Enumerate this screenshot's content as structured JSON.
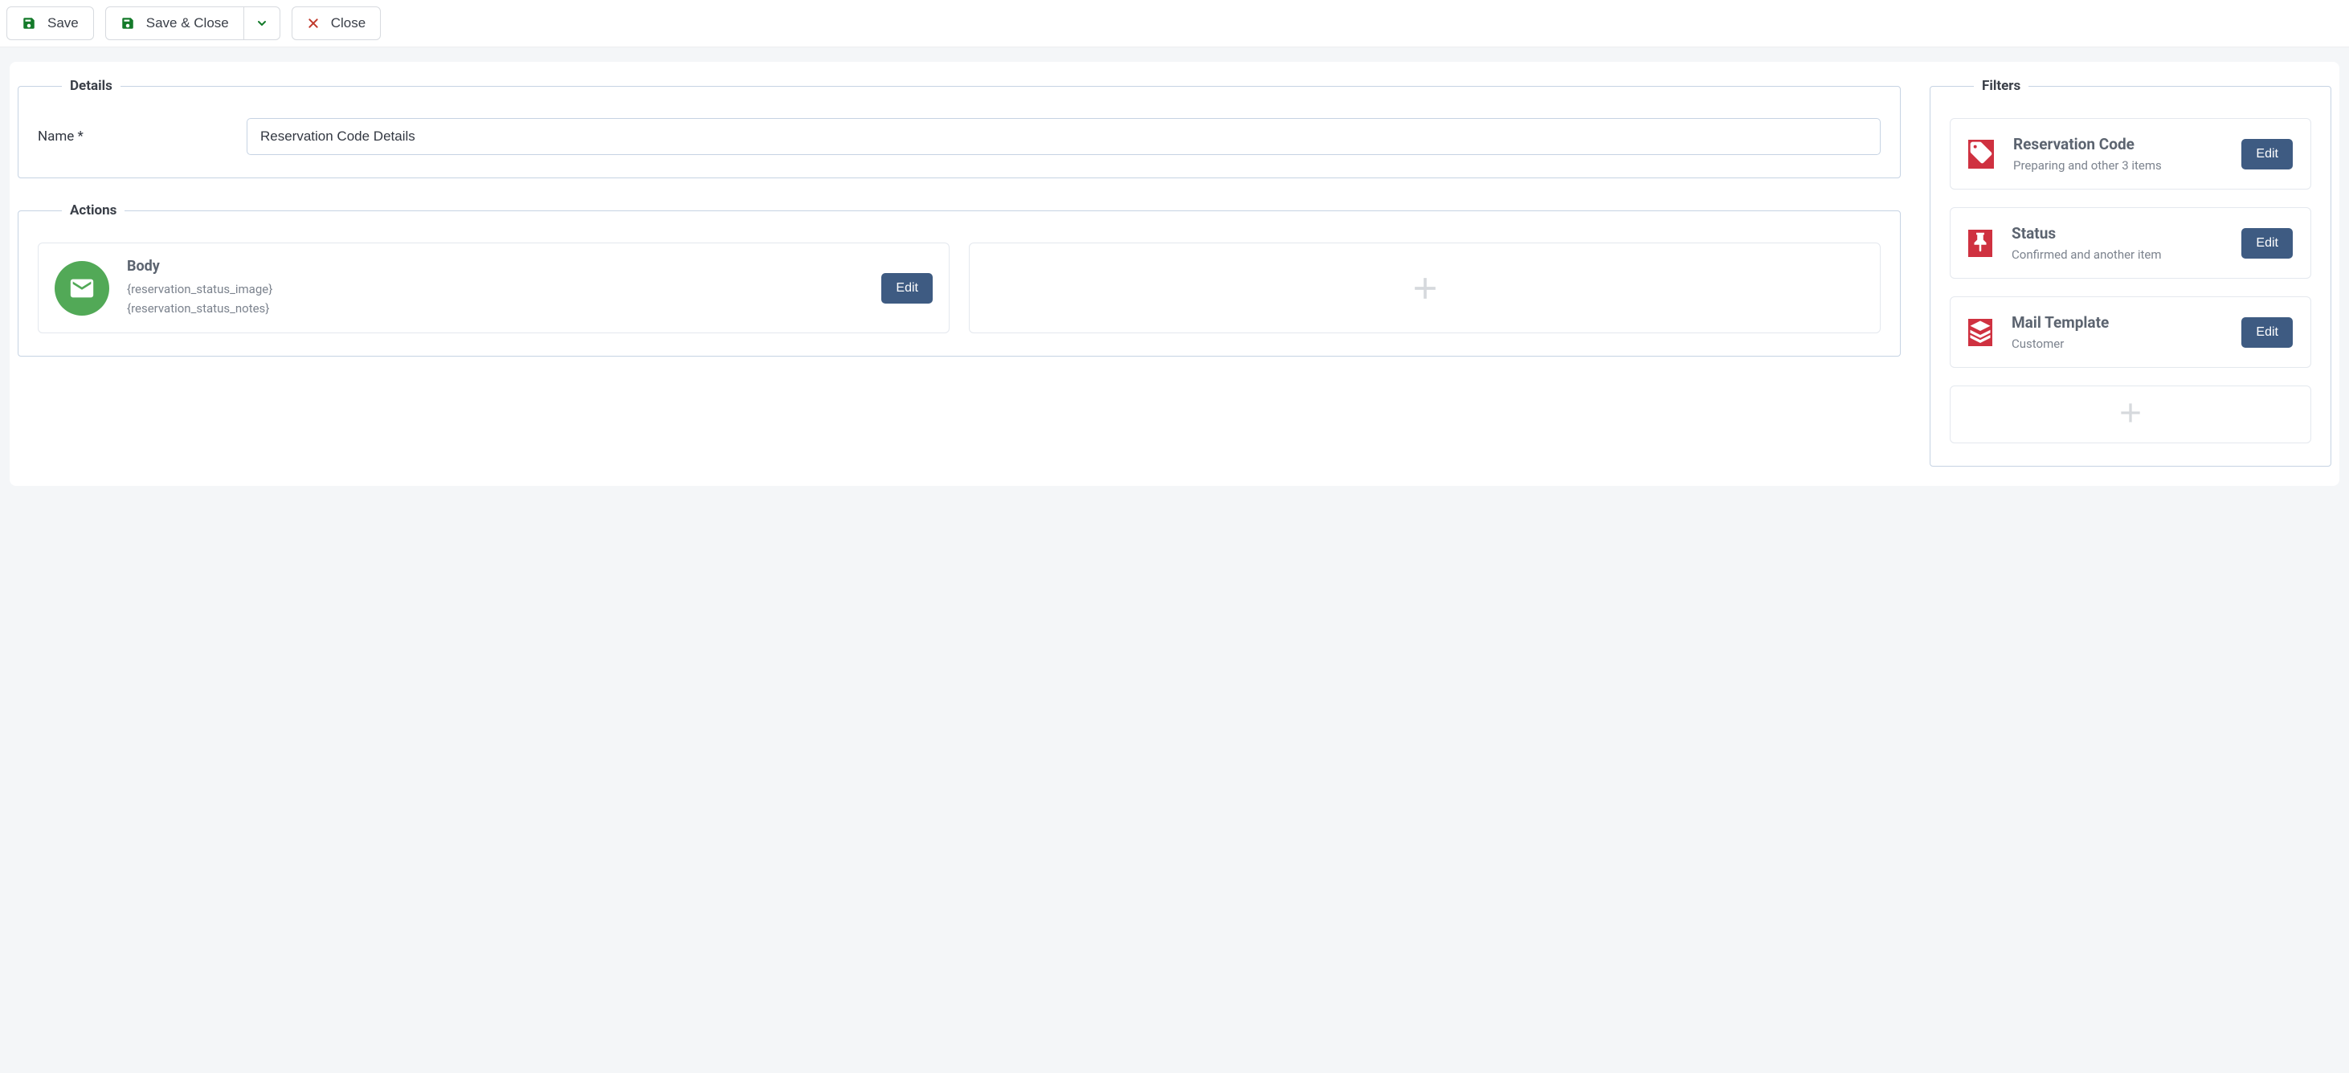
{
  "toolbar": {
    "save_label": "Save",
    "save_close_label": "Save & Close",
    "close_label": "Close"
  },
  "details": {
    "legend": "Details",
    "name_label": "Name *",
    "name_value": "Reservation Code Details"
  },
  "actions": {
    "legend": "Actions",
    "edit_label": "Edit",
    "items": [
      {
        "title": "Body",
        "sub_line1": "{reservation_status_image}",
        "sub_line2": "{reservation_status_notes}",
        "icon": "envelope",
        "color": "green"
      }
    ]
  },
  "filters": {
    "legend": "Filters",
    "edit_label": "Edit",
    "items": [
      {
        "title": "Reservation Code",
        "sub": "Preparing and other 3 items",
        "icon": "tag"
      },
      {
        "title": "Status",
        "sub": "Confirmed and another item",
        "icon": "pin"
      },
      {
        "title": "Mail Template",
        "sub": "Customer",
        "icon": "layers"
      }
    ]
  }
}
